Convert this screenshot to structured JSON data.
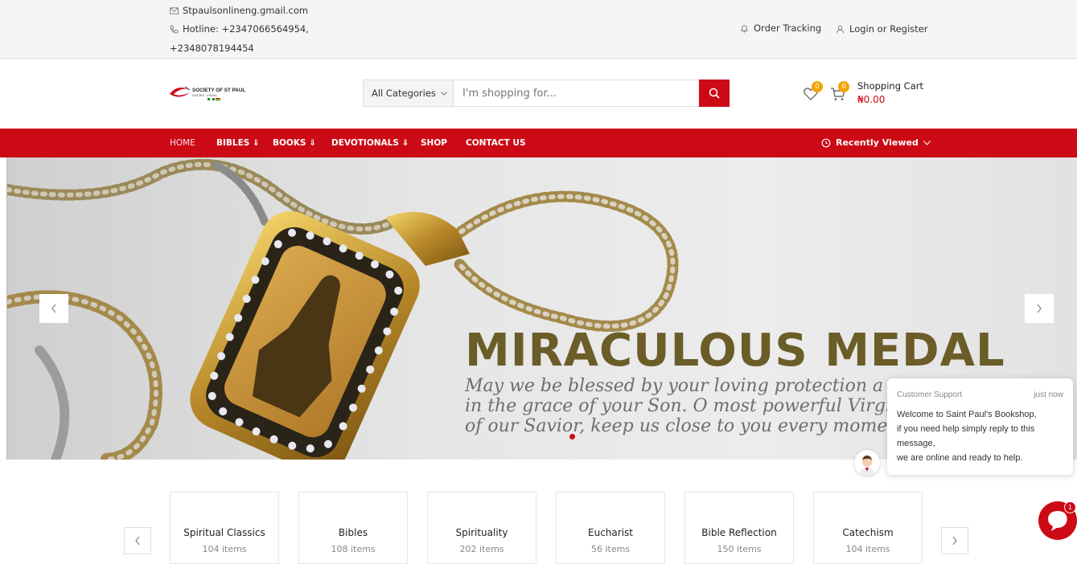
{
  "topbar": {
    "email": "Stpaulsonlineng.gmail.com",
    "hotline": "Hotline: +2347066564954,",
    "hotline2": "+2348078194454",
    "order_tracking": "Order Tracking",
    "login": "Login or Register"
  },
  "header": {
    "logo_text": "SOCIETY OF ST PAUL",
    "logo_sub": "NIGERIA - GHANA",
    "category_select": "All Categories",
    "search_placeholder": "I'm shopping for...",
    "wishlist_count": "0",
    "cart_count": "0",
    "cart_label": "Shopping Cart",
    "cart_total": "₦0.00"
  },
  "nav": {
    "items": [
      "HOME",
      "BIBLES ⇓",
      "BOOKS ⇓",
      "DEVOTIONALS ⇓",
      "SHOP",
      "CONTACT US"
    ],
    "recently_viewed": "Recently Viewed"
  },
  "hero": {
    "title": "MIRACULOUS MEDAL",
    "lines": [
      "May we be blessed by your loving protection a",
      "in the grace of your Son. O most powerful Virgi",
      "of our Savior, keep us close to you every mome"
    ]
  },
  "chat": {
    "header": "Customer Support",
    "time": "just now",
    "lines": [
      "Welcome to Saint Paul's Bookshop,",
      "if you need help simply reply to this",
      "message,",
      "we are online and ready to help."
    ],
    "unread": "1"
  },
  "categories": [
    {
      "name": "Spiritual Classics",
      "count": "104 items"
    },
    {
      "name": "Bibles",
      "count": "108 items"
    },
    {
      "name": "Spirituality",
      "count": "202 items"
    },
    {
      "name": "Eucharist",
      "count": "56 items"
    },
    {
      "name": "Bible Reflection",
      "count": "150 items"
    },
    {
      "name": "Catechism",
      "count": "104 items"
    }
  ],
  "colors": {
    "brand_red": "#cc0a16",
    "badge_orange": "#f4a300",
    "title_gold": "#6b5d28"
  }
}
